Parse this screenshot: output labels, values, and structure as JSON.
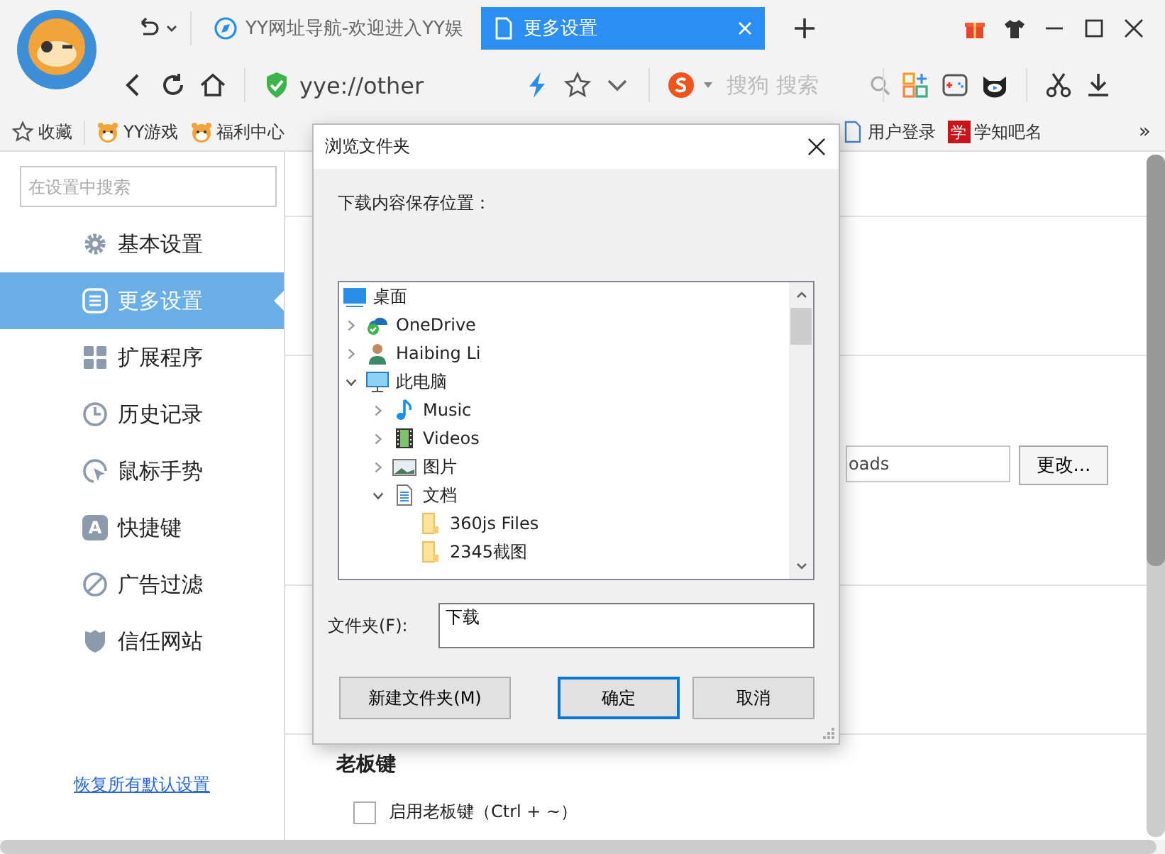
{
  "tabs": [
    {
      "title": "YY网址导航-欢迎进入YY娱",
      "selected": false,
      "kind": "nav"
    },
    {
      "title": "更多设置",
      "selected": true,
      "kind": "page"
    }
  ],
  "address_bar": {
    "url": "yye://other",
    "search_placeholder": "搜狗 搜索"
  },
  "bookmarks": [
    {
      "label": "收藏",
      "kind": "star"
    },
    {
      "label": "YY游戏",
      "kind": "tiger"
    },
    {
      "label": "福利中心",
      "kind": "tiger"
    },
    {
      "label": "用户登录",
      "kind": "page"
    },
    {
      "label": "学知吧名",
      "kind": "badge",
      "icon_text": "学"
    }
  ],
  "bookmarks_more": "»",
  "sidebar": {
    "search_placeholder": "在设置中搜索",
    "items": [
      {
        "label": "基本设置",
        "kind": "gear",
        "selected": false
      },
      {
        "label": "更多设置",
        "kind": "list",
        "selected": true
      },
      {
        "label": "扩展程序",
        "kind": "grid",
        "selected": false
      },
      {
        "label": "历史记录",
        "kind": "clock",
        "selected": false
      },
      {
        "label": "鼠标手势",
        "kind": "gesture",
        "selected": false
      },
      {
        "label": "快捷键",
        "kind": "letter",
        "icon_text": "A",
        "selected": false
      },
      {
        "label": "广告过滤",
        "kind": "ban",
        "selected": false
      },
      {
        "label": "信任网站",
        "kind": "shield",
        "selected": false
      }
    ],
    "reset_link": "恢复所有默认设置"
  },
  "settings": {
    "download_path": "oads",
    "change_button": "更改...",
    "boss_key_heading": "老板键",
    "boss_key_checkbox": {
      "label": "启用老板键（Ctrl + ~）",
      "checked": false
    }
  },
  "dialog": {
    "title": "浏览文件夹",
    "prompt": "下载内容保存位置：",
    "tree": [
      {
        "label": "桌面",
        "kind": "desktop",
        "children": [
          {
            "label": "OneDrive",
            "kind": "onedrive",
            "expanded": false
          },
          {
            "label": "Haibing Li",
            "kind": "user",
            "expanded": false
          },
          {
            "label": "此电脑",
            "kind": "computer",
            "expanded": true,
            "children": [
              {
                "label": "Music",
                "kind": "music",
                "expanded": false
              },
              {
                "label": "Videos",
                "kind": "videos",
                "expanded": false
              },
              {
                "label": "图片",
                "kind": "pictures",
                "expanded": false
              },
              {
                "label": "文档",
                "kind": "documents",
                "expanded": true,
                "children": [
                  {
                    "label": "360js Files",
                    "kind": "folder"
                  },
                  {
                    "label": "2345截图",
                    "kind": "folder"
                  }
                ]
              }
            ]
          }
        ]
      }
    ],
    "folder_label": "文件夹(F):",
    "folder_value": "下载",
    "buttons": [
      {
        "label": "新建文件夹(M)",
        "default": false
      },
      {
        "label": "确定",
        "default": true
      },
      {
        "label": "取消",
        "default": false
      }
    ]
  }
}
